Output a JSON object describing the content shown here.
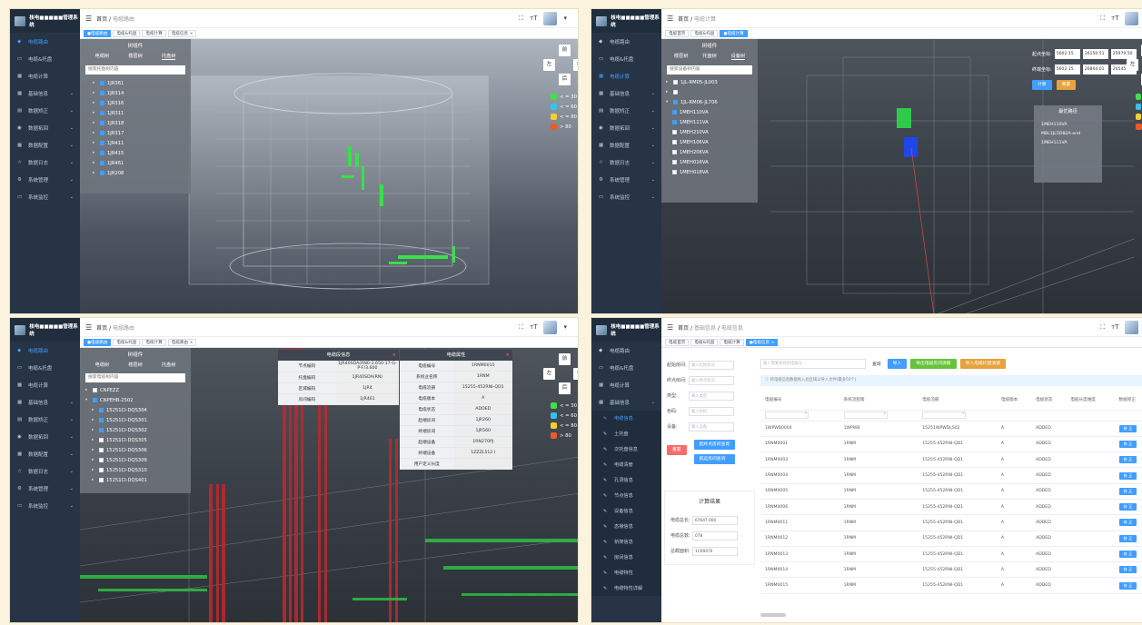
{
  "app": {
    "brand": "核电■■■■■管理系统",
    "user_caret": "▾",
    "top_icons": {
      "fullscreen": "⛶",
      "font_size": "тT"
    }
  },
  "nav": {
    "items": [
      "电缆路由",
      "电缆&托盘",
      "电缆计算",
      "基础信息",
      "数据矫正",
      "数据拓回",
      "数据配置",
      "数据日志",
      "系统管理",
      "系统监控"
    ],
    "sub_items_p4": [
      "电缆信息",
      "土托盘",
      "次托盘信息",
      "电缆清册",
      "孔洞信息",
      "节点信息",
      "设备信息",
      "态接信息",
      "桥架信息",
      "房间信息",
      "电缆特性",
      "电缆特性详解"
    ]
  },
  "breadcrumbs": {
    "p1": [
      "首页",
      "电缆路由"
    ],
    "p2": [
      "首页",
      "电缆计算"
    ],
    "p3": [
      "首页",
      "电缆路由"
    ],
    "p4": [
      "首页",
      "基础信息",
      "电缆信息"
    ]
  },
  "tabs": {
    "p1": [
      "●电缆路由",
      "电缆&托盘",
      "电缆计算",
      "电缆信息 ×"
    ],
    "p2": [
      "电缆首页",
      "电缆&托盘",
      "●电缆计算"
    ],
    "p3": [
      "●电缆路由",
      "电缆&托盘",
      "电缆计算",
      "电缆路由 ×"
    ],
    "p4": [
      "电缆首页",
      "电缆&托盘",
      "电缆计算",
      "●电缆信息 ×"
    ]
  },
  "tree": {
    "title": "树组件",
    "tabs": [
      "电缆树",
      "楼层树",
      "托盘树"
    ],
    "tabs_p2": [
      "楼层树",
      "托盘树",
      "设备树"
    ],
    "p1_search": "搜索托盘树内容",
    "p1_nodes": [
      "1JR361",
      "1JR314",
      "1JR316",
      "1JR311",
      "1JR318",
      "1JR317",
      "1JR411",
      "1JR415",
      "1JR461",
      "1JR208"
    ],
    "p2_search": "搜索设备树内容",
    "p2_groups": [
      "1JL-RM05-JL003",
      "",
      "1JL-RM06-JL706"
    ],
    "p2_nodes": [
      "1MEH110VA",
      "1MEH111VA",
      "1MEH210VA",
      "1MEH106VA",
      "1MEH206VA",
      "1MEH016VA",
      "1MEH018VA"
    ],
    "p3_search": "搜索电缆树内容",
    "p3_groups": [
      "CNPEZZ",
      "CNPEHB-2502"
    ],
    "p3_nodes": [
      "15251CI-DQS304",
      "15251CI-DQS301",
      "15251CI-DQS302",
      "15251CI-DQS305",
      "15251CI-DQS306",
      "15251CI-DQS309",
      "15251CI-DQS310",
      "15251CI-DQS401"
    ]
  },
  "viewbtns": {
    "front": "前",
    "left": "左",
    "right": "右",
    "back": "后"
  },
  "legend": [
    "< = 30",
    "< = 60",
    "< = 80",
    "> 80"
  ],
  "colors": {
    "legend": [
      "#3ee04a",
      "#35c2f0",
      "#f5d02a",
      "#f05a28"
    ],
    "primary": "#409eff"
  },
  "p2_calc": {
    "start_label": "起点坐标:",
    "start": [
      "5602.15",
      "26150.51",
      "25979.50"
    ],
    "end_label": "终端坐标:",
    "end": [
      "5602.15",
      "26844.01",
      "24545.00"
    ],
    "calc_btn": "计算",
    "reset_btn": "重置",
    "path_title": "最优路径",
    "path": [
      "1MEH110VA",
      "MBL1JL5D82A-end",
      "1MEH111VA"
    ]
  },
  "p3_panel1": {
    "title": "电缆段信息",
    "rows": [
      {
        "k": "节点编码",
        "v": "1JR40SDA(RN0-3.650-17-G-P-F/3.600"
      },
      {
        "k": "托盘编码",
        "v": "1JR40SDA(RN)"
      },
      {
        "k": "区域编码",
        "v": "1JR4"
      },
      {
        "k": "房间编码",
        "v": "1JR461"
      }
    ]
  },
  "p3_panel2": {
    "title": "电缆属性",
    "rows": [
      {
        "k": "电缆编号",
        "v": "1RNM0015"
      },
      {
        "k": "系统业名称",
        "v": "1RNM"
      },
      {
        "k": "电缆流册",
        "v": "15255-452RNI-QD1"
      },
      {
        "k": "电缆版本",
        "v": "A"
      },
      {
        "k": "电缆状态",
        "v": "ADDED"
      },
      {
        "k": "起端房间",
        "v": "1JR260"
      },
      {
        "k": "终端房间",
        "v": "1JR560"
      },
      {
        "k": "起端设备",
        "v": "1RN270PJ"
      },
      {
        "k": "终端设备",
        "v": "1ZZZL512 I"
      },
      {
        "k": "用户定义长度",
        "v": ""
      }
    ]
  },
  "p4_form": {
    "fields": [
      {
        "label": "起始房间:",
        "ph": "输入起始房间"
      },
      {
        "label": "终点房间:",
        "ph": "输入终点房间"
      },
      {
        "label": "类型:",
        "ph": "输入类型"
      },
      {
        "label": "色码:",
        "ph": "输入色码"
      },
      {
        "label": "设备:",
        "ph": "输入设备"
      }
    ],
    "reset": "重置",
    "btn_start": "起终点房间查询",
    "btn_end": "航运房间查询",
    "result_title": "计算结果",
    "results": [
      {
        "label": "电缆总长:",
        "value": "67647.000"
      },
      {
        "label": "电缆总数:",
        "value": "078"
      },
      {
        "label": "总截面积:",
        "value": "1C09470"
      }
    ]
  },
  "p4_table": {
    "search_ph": "输入需要查找的电缆号...",
    "query": "查询",
    "import": "导入",
    "export_room": "导出电缆房间清册",
    "export_tray": "导入电缆托盘清册",
    "info": "将电缆信息数据拖入此区域以导入文件(最多50个)",
    "headers": [
      "电缆编号",
      "系统流程版",
      "电缆流册",
      "电缆版本",
      "电缆状态",
      "电缆长度维度",
      "数据修正"
    ],
    "rows": [
      [
        "1WPWB0004",
        "1WPWB",
        "15251WPWDLS02",
        "A",
        "ADDED"
      ],
      [
        "1RNM0001",
        "1RNM",
        "15255-452RNI-QD1",
        "A",
        "ADDED"
      ],
      [
        "1RNM0003",
        "1RNM",
        "15255-452RNI-QD1",
        "A",
        "ADDED"
      ],
      [
        "1RNM0004",
        "1RNM",
        "15255-452RNI-QD1",
        "A",
        "ADDED"
      ],
      [
        "1RNM0005",
        "1RNM",
        "15255-452RNI-QD1",
        "A",
        "ADDED"
      ],
      [
        "1RNM0006",
        "1RNM",
        "15255-452RNI-QD1",
        "A",
        "ADDED"
      ],
      [
        "1RNM0011",
        "1RNM",
        "15255-452RNI-QD1",
        "A",
        "ADDED"
      ],
      [
        "1RNM0012",
        "1RNM",
        "15255-452RNI-QD1",
        "A",
        "ADDED"
      ],
      [
        "1RNM0013",
        "1RNM",
        "15255-452RNI-QD1",
        "A",
        "ADDED"
      ],
      [
        "1RNM0014",
        "1RNM",
        "15255-452RNI-QD1",
        "A",
        "ADDED"
      ],
      [
        "1RNM0015",
        "1RNM",
        "15255-452RNI-QD1",
        "A",
        "ADDED"
      ]
    ],
    "row_btn": "修 正"
  }
}
